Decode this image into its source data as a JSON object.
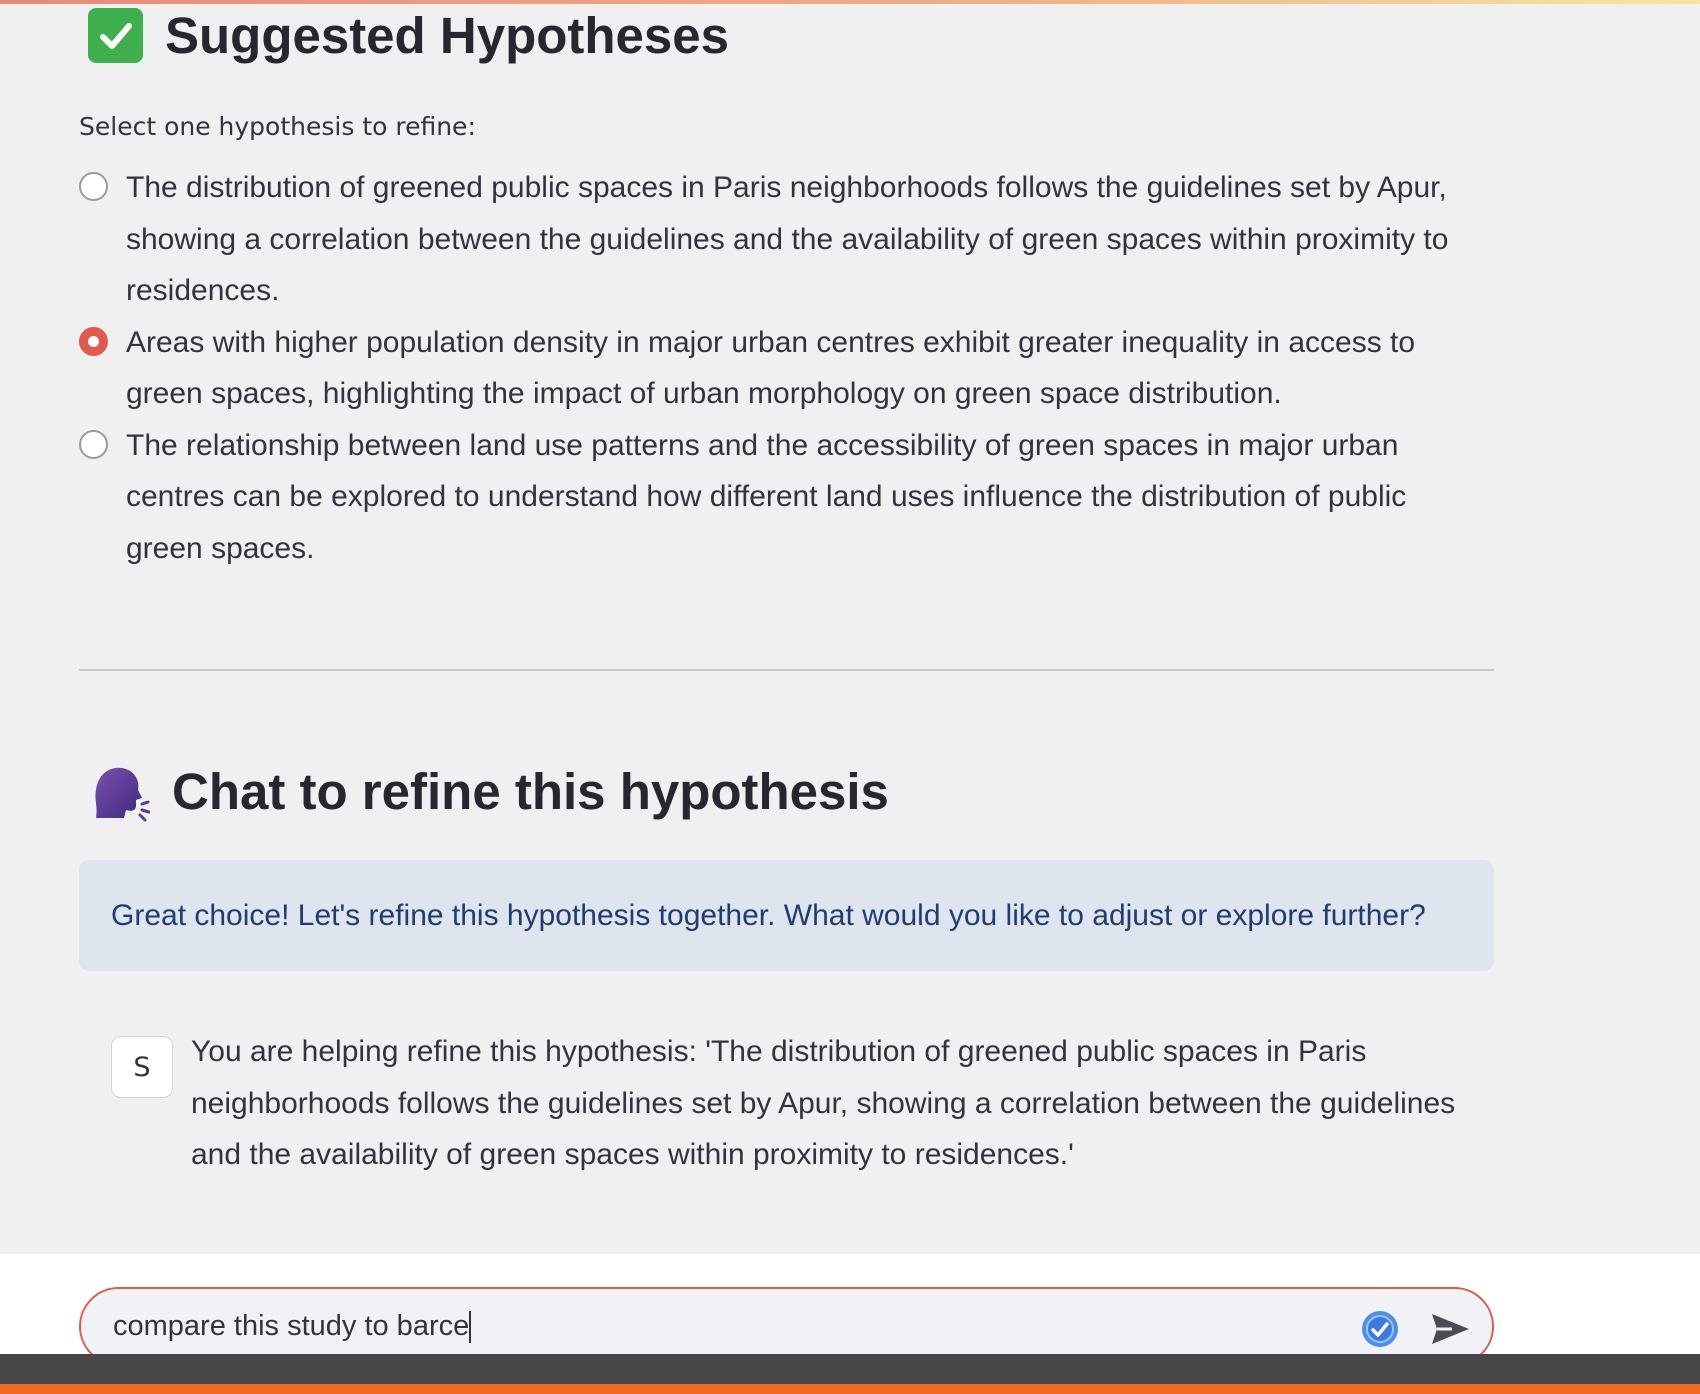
{
  "hypotheses_section": {
    "title": "Suggested Hypotheses",
    "select_label": "Select one hypothesis to refine:",
    "options": [
      {
        "text": "The distribution of greened public spaces in Paris neighborhoods follows the guidelines set by Apur, showing a correlation between the guidelines and the availability of green spaces within proximity to residences.",
        "selected": false
      },
      {
        "text": "Areas with higher population density in major urban centres exhibit greater inequality in access to green spaces, highlighting the impact of urban morphology on green space distribution.",
        "selected": true
      },
      {
        "text": "The relationship between land use patterns and the accessibility of green spaces in major urban centres can be explored to understand how different land uses influence the distribution of public green spaces.",
        "selected": false
      }
    ]
  },
  "chat_section": {
    "title": "Chat to refine this hypothesis",
    "info_message": "Great choice! Let's refine this hypothesis together. What would you like to adjust or explore further?",
    "messages": [
      {
        "avatar": "S",
        "text": "You are helping refine this hypothesis: 'The distribution of greened public spaces in Paris neighborhoods follows the guidelines set by Apur, showing a correlation between the guidelines and the availability of green spaces within proximity to residences.'"
      }
    ],
    "input_value": "compare this study to barce"
  },
  "colors": {
    "accent": "#e05a4e",
    "info_bg": "#dfe5ee",
    "info_text": "#1e3e72",
    "page_bg": "#f0f0f0"
  },
  "icons": {
    "hypotheses": "check-mark-button-icon",
    "chat": "speaking-head-icon",
    "input_badge": "check-badge-icon",
    "send": "send-icon"
  }
}
